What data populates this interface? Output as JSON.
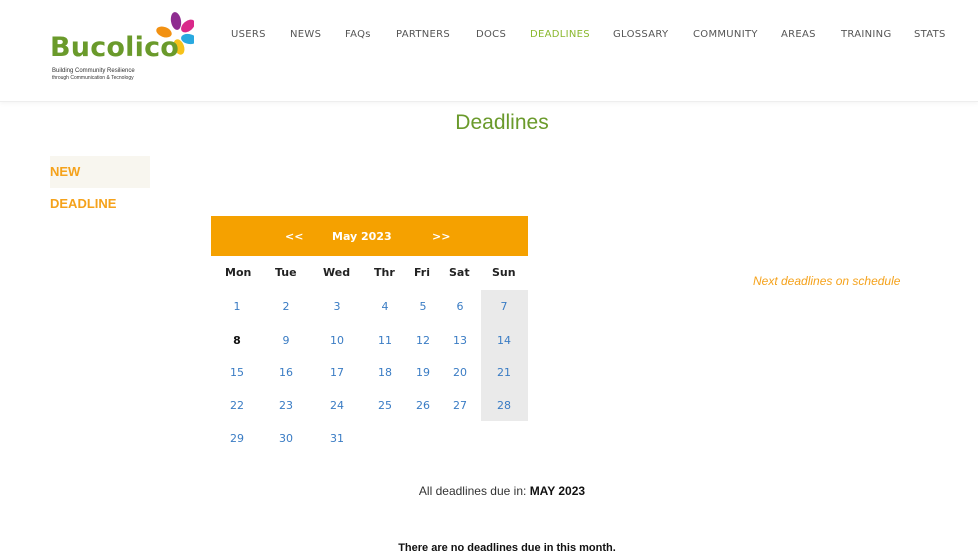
{
  "logo": {
    "name": "Bucolico",
    "tagline_line1": "Building Community Resilience",
    "tagline_line2": "through Communication & Tecnology"
  },
  "nav": {
    "items": [
      "USERS",
      "NEWS",
      "FAQs",
      "PARTNERS",
      "DOCS",
      "DEADLINES",
      "GLOSSARY",
      "COMMUNITY",
      "AREAS",
      "TRAINING",
      "STATS"
    ],
    "active": "DEADLINES"
  },
  "page": {
    "title": "Deadlines"
  },
  "actions": {
    "new_deadline": "NEW DEADLINE"
  },
  "calendar": {
    "prev": "<<",
    "month_label": "May 2023",
    "next": ">>",
    "weekdays": [
      "Mon",
      "Tue",
      "Wed",
      "Thr",
      "Fri",
      "Sat",
      "Sun"
    ],
    "weeks": [
      [
        "1",
        "2",
        "3",
        "4",
        "5",
        "6",
        "7"
      ],
      [
        "8",
        "9",
        "10",
        "11",
        "12",
        "13",
        "14"
      ],
      [
        "15",
        "16",
        "17",
        "18",
        "19",
        "20",
        "21"
      ],
      [
        "22",
        "23",
        "24",
        "25",
        "26",
        "27",
        "28"
      ],
      [
        "29",
        "30",
        "31",
        "",
        "",
        "",
        ""
      ]
    ],
    "today": "8"
  },
  "sidebar": {
    "next_deadlines": "Next deadlines on schedule"
  },
  "summary": {
    "prefix": "All deadlines due in:",
    "month": "MAY 2023"
  },
  "empty_message": "There are no deadlines due in this month.",
  "colors": {
    "brand_green": "#6a9a2b",
    "accent_orange": "#f5a100",
    "link_blue": "#3a7cc4"
  }
}
